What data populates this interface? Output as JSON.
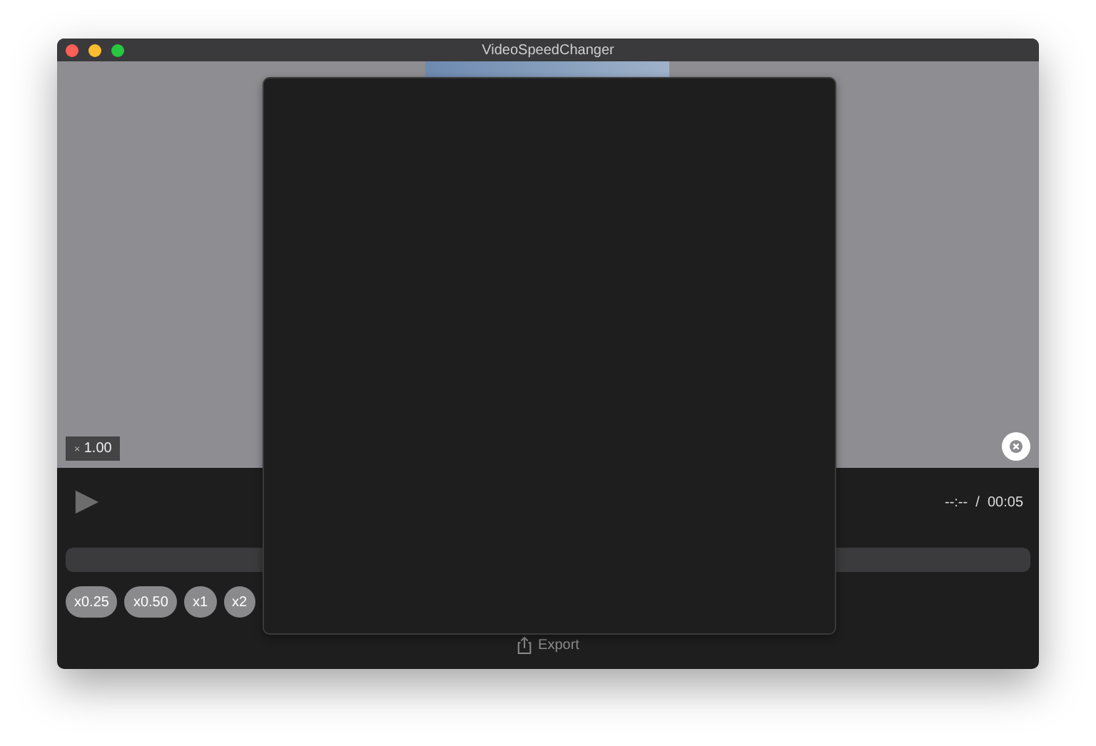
{
  "window": {
    "title": "VideoSpeedChanger"
  },
  "video": {
    "speed_badge": {
      "symbol": "×",
      "value": "1.00"
    }
  },
  "player": {
    "time": "--:--  /  00:05"
  },
  "speeds": [
    {
      "label": "x0.25"
    },
    {
      "label": "x0.50"
    },
    {
      "label": "x1"
    },
    {
      "label": "x2"
    }
  ],
  "export": {
    "label": "Export",
    "disabled": true
  },
  "overlay_panel": {
    "kind": "empty"
  }
}
